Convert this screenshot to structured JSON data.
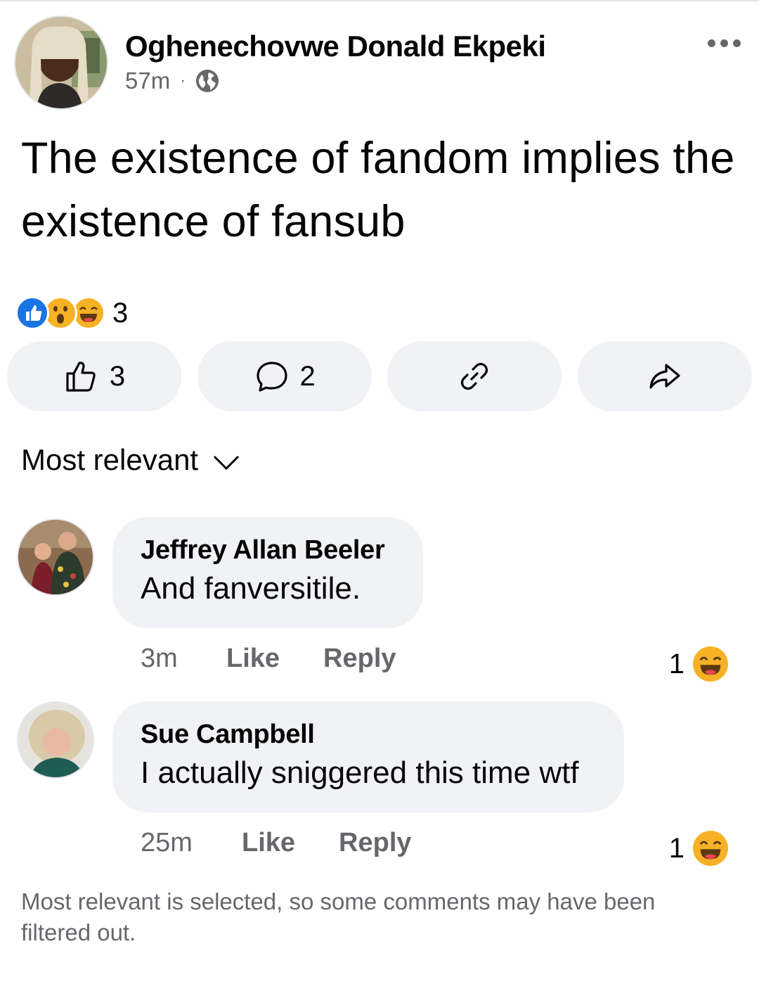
{
  "post": {
    "author": "Oghenechovwe Donald Ekpeki",
    "time": "57m",
    "separator": "·",
    "privacy_icon": "globe-icon",
    "text": "The existence of fandom implies the existence of fansub",
    "reactions": {
      "types": [
        "like",
        "wow",
        "haha"
      ],
      "count": "3"
    },
    "actions": {
      "like_count": "3",
      "comment_count": "2"
    }
  },
  "sort": {
    "label": "Most relevant"
  },
  "comments": [
    {
      "name": "Jeffrey Allan Beeler",
      "text": "And fanversitile.",
      "time": "3m",
      "like": "Like",
      "reply": "Reply",
      "reaction_count": "1",
      "reaction": "haha"
    },
    {
      "name": "Sue Campbell",
      "text": "I actually sniggered this time wtf",
      "time": "25m",
      "like": "Like",
      "reply": "Reply",
      "reaction_count": "1",
      "reaction": "haha"
    }
  ],
  "footer_note": "Most relevant is selected, so some comments may have been filtered out.",
  "colors": {
    "primary_text": "#050505",
    "secondary_text": "#65676b",
    "button_bg": "#f0f2f5",
    "like_blue": "#1b74e4",
    "emoji_yellow": "#f7b125"
  }
}
